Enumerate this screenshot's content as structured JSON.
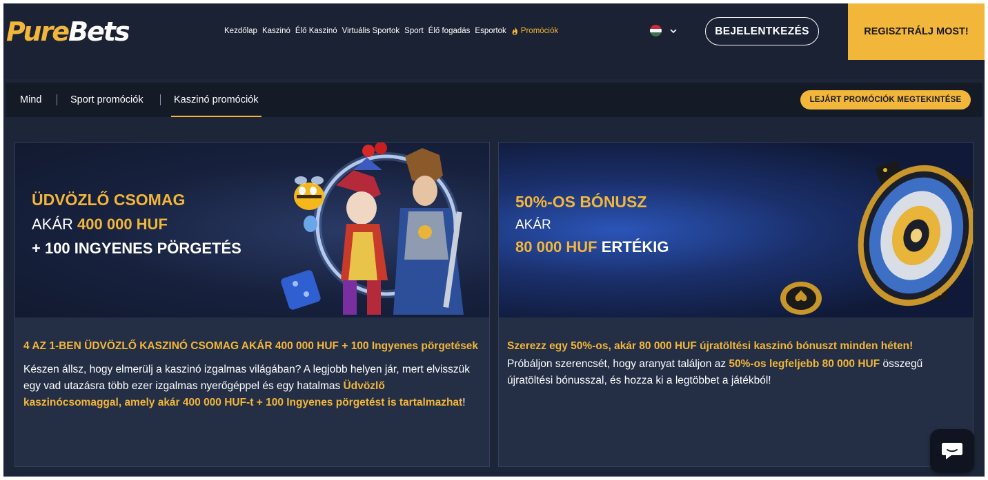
{
  "header": {
    "logo_part1": "Pure",
    "logo_part2": "Bets",
    "nav": [
      {
        "label": "Kezdőlap"
      },
      {
        "label": "Kaszinó"
      },
      {
        "label": "Élő Kaszinó"
      },
      {
        "label": "Virtuális Sportok"
      },
      {
        "label": "Sport"
      },
      {
        "label": "Élő fogadás"
      },
      {
        "label": "Esportok"
      },
      {
        "label": "Promóciók",
        "icon": "flame-icon"
      }
    ],
    "language_flag": "hungary-flag-icon",
    "login_label": "BEJELENTKEZÉS",
    "register_label": "REGISZTRÁLJ MOST!"
  },
  "tabs": {
    "items": [
      {
        "label": "Mind"
      },
      {
        "label": "Sport promóciók"
      },
      {
        "label": "Kaszinó promóciók"
      }
    ],
    "active": "Kaszinó promóciók",
    "expired_label": "LEJÁRT PROMÓCIÓK MEGTEKINTÉSE"
  },
  "cards": [
    {
      "banner_line1": "ÜDVÖZLŐ CSOMAG",
      "banner_line2_prefix": "AKÁR ",
      "banner_line2_amount": "400 000 HUF",
      "banner_line3": "+ 100 INGYENES PÖRGETÉS",
      "title": "4 AZ 1-BEN ÜDVÖZLŐ KASZINÓ CSOMAG AKÁR 400 000 HUF + 100 Ingyenes pörgetések",
      "text_plain": "Készen állsz, hogy elmerülj a kaszinó izgalmas világában? A legjobb helyen jár, mert elvisszük egy vad utazásra több ezer izgalmas nyerőgéppel és egy hatalmas ",
      "text_highlight": "Üdvözlő kaszinócsomaggal, amely akár 400 000 HUF-t + 100 Ingyenes pörgetést is tartalmazhat",
      "text_end": "!"
    },
    {
      "banner_line1": "50%-OS BÓNUSZ",
      "banner_line2": "AKÁR",
      "banner_line3_amount": "80 000 HUF",
      "banner_line3_suffix": " ERTÉKIG",
      "title": "Szerezz egy 50%-os, akár 80 000 HUF újratöltési kaszinó bónuszt minden héten!",
      "text_plain": "Próbáljon szerencsét, hogy aranyat találjon az ",
      "text_highlight": "50%-os legfeljebb 80 000 HUF",
      "text_end": " összegű újratöltési bónusszal, és hozza ki a legtöbbet a játékból!"
    }
  ],
  "colors": {
    "accent": "#f2b63a",
    "background": "#1d2638",
    "header": "#1b2233",
    "card": "#242f45"
  },
  "chat_icon": "chat-bubble-icon"
}
